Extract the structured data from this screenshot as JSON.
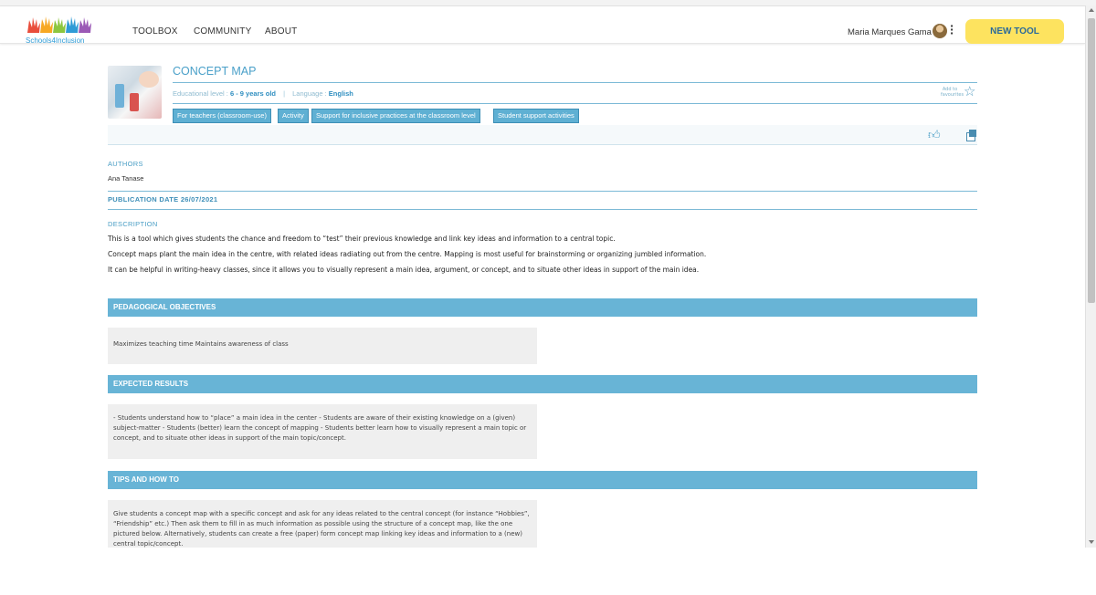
{
  "header": {
    "logo_text": "Schools4Inclusion",
    "nav": [
      "TOOLBOX",
      "COMMUNITY",
      "ABOUT"
    ],
    "user_name": "Maria Marques Gama",
    "new_tool_label": "NEW TOOL"
  },
  "tool": {
    "title": "CONCEPT MAP",
    "educational_level_label": "Educational level :",
    "educational_level_value": "6 - 9 years old",
    "separator": "|",
    "language_label": "Language :",
    "language_value": "English",
    "favourites_label": "Add to favourites",
    "tags": [
      "For teachers (classroom-use)",
      "Activity",
      "Support for inclusive practices at the classroom level",
      "Student support activities"
    ]
  },
  "authors": {
    "heading": "AUTHORS",
    "name": "Ana Tanase"
  },
  "publication": {
    "text": "PUBLICATION DATE 26/07/2021"
  },
  "description": {
    "heading": "DESCRIPTION",
    "lines": [
      "This is a tool which gives students the chance and freedom to “test” their previous knowledge and link key ideas and information to a central topic.",
      "Concept maps plant the main idea in the centre, with related ideas radiating out from the centre. Mapping is most useful for brainstorming or organizing jumbled information.",
      "It can be helpful in writing-heavy classes, since it allows you to visually represent a main idea, argument, or concept, and to situate other ideas in support of the main idea."
    ]
  },
  "sections": {
    "objectives": {
      "title": "PEDAGOGICAL OBJECTIVES",
      "body": "Maximizes teaching time Maintains awareness of class"
    },
    "results": {
      "title": "EXPECTED RESULTS",
      "body": "- Students understand how to “place” a main idea in the center - Students are aware of their existing knowledge on a (given) subject-matter - Students (better) learn the concept of mapping - Students better learn how to visually represent a main topic or concept, and to situate other ideas in support of the main topic/concept."
    },
    "tips": {
      "title": "TIPS AND HOW TO",
      "body": "Give students a concept map with a specific concept and ask for any ideas related to the central concept (for instance “Hobbies”, “Friendship” etc.) Then ask them to fill in as much information as possible using the structure of a concept map, like the one pictured below. Alternatively, students can create a free (paper) form concept map linking key ideas and information to a (new) central topic/concept."
    }
  }
}
